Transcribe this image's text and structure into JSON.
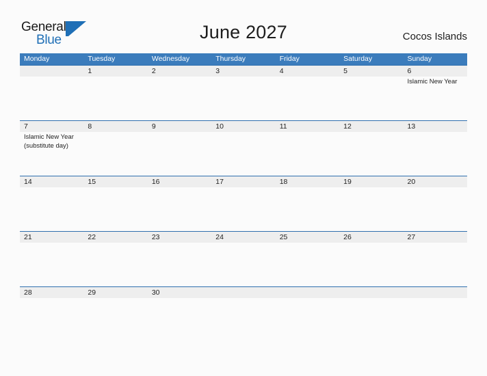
{
  "header": {
    "logo": {
      "text_top": "General",
      "text_bottom": "Blue",
      "mark": "flag-triangle"
    },
    "title": "June 2027",
    "region": "Cocos Islands"
  },
  "calendar": {
    "day_headers": [
      "Monday",
      "Tuesday",
      "Wednesday",
      "Thursday",
      "Friday",
      "Saturday",
      "Sunday"
    ],
    "colors": {
      "header_blue": "#3b7cbc",
      "row_line_blue": "#2f6fae",
      "band_gray": "#eeeeee",
      "page_background": "#fbfbfb",
      "text": "#222222",
      "logo_blue": "#1f6fb6"
    },
    "weeks": [
      {
        "cells": [
          {
            "day": "",
            "events": []
          },
          {
            "day": "1",
            "events": []
          },
          {
            "day": "2",
            "events": []
          },
          {
            "day": "3",
            "events": []
          },
          {
            "day": "4",
            "events": []
          },
          {
            "day": "5",
            "events": []
          },
          {
            "day": "6",
            "events": [
              "Islamic New Year"
            ]
          }
        ]
      },
      {
        "cells": [
          {
            "day": "7",
            "events": [
              "Islamic New Year",
              "(substitute day)"
            ]
          },
          {
            "day": "8",
            "events": []
          },
          {
            "day": "9",
            "events": []
          },
          {
            "day": "10",
            "events": []
          },
          {
            "day": "11",
            "events": []
          },
          {
            "day": "12",
            "events": []
          },
          {
            "day": "13",
            "events": []
          }
        ]
      },
      {
        "cells": [
          {
            "day": "14",
            "events": []
          },
          {
            "day": "15",
            "events": []
          },
          {
            "day": "16",
            "events": []
          },
          {
            "day": "17",
            "events": []
          },
          {
            "day": "18",
            "events": []
          },
          {
            "day": "19",
            "events": []
          },
          {
            "day": "20",
            "events": []
          }
        ]
      },
      {
        "cells": [
          {
            "day": "21",
            "events": []
          },
          {
            "day": "22",
            "events": []
          },
          {
            "day": "23",
            "events": []
          },
          {
            "day": "24",
            "events": []
          },
          {
            "day": "25",
            "events": []
          },
          {
            "day": "26",
            "events": []
          },
          {
            "day": "27",
            "events": []
          }
        ]
      },
      {
        "cells": [
          {
            "day": "28",
            "events": []
          },
          {
            "day": "29",
            "events": []
          },
          {
            "day": "30",
            "events": []
          },
          {
            "day": "",
            "events": []
          },
          {
            "day": "",
            "events": []
          },
          {
            "day": "",
            "events": []
          },
          {
            "day": "",
            "events": []
          }
        ]
      }
    ]
  }
}
